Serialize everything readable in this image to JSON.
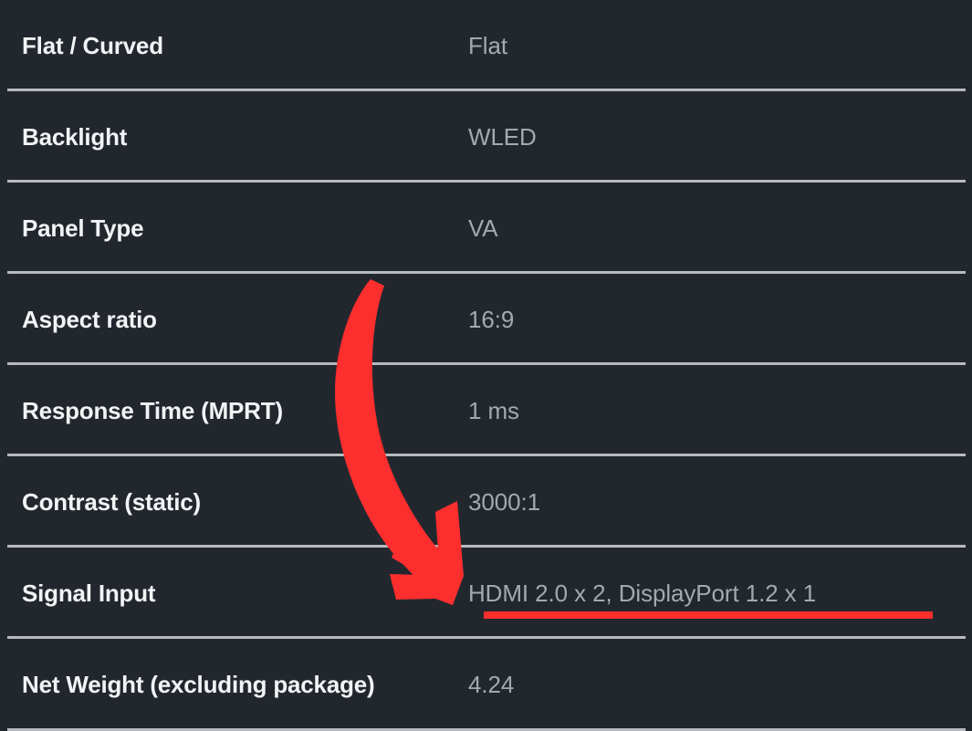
{
  "theme": {
    "background": "#22272e",
    "separator": "#b7babe",
    "label_color": "#f2f3f5",
    "value_color": "#a4a9b0",
    "marker_color": "#fc2e2e"
  },
  "spec_table": {
    "rows": [
      {
        "label": "Flat / Curved",
        "value": "Flat"
      },
      {
        "label": "Backlight",
        "value": "WLED"
      },
      {
        "label": "Panel Type",
        "value": "VA"
      },
      {
        "label": "Aspect ratio",
        "value": "16:9"
      },
      {
        "label": "Response Time (MPRT)",
        "value": "1 ms"
      },
      {
        "label": "Contrast (static)",
        "value": "3000:1"
      },
      {
        "label": "Signal Input",
        "value": "HDMI 2.0 x 2, DisplayPort 1.2 x 1"
      },
      {
        "label": "Net Weight (excluding package)",
        "value": "4.24"
      }
    ]
  },
  "annotations": {
    "arrow": {
      "name": "red-arrow-annotation",
      "color": "#fc2e2e",
      "points_to": "Signal Input value"
    },
    "underline": {
      "name": "red-underline-annotation",
      "color": "#fc2e2e",
      "underlines": "HDMI 2.0 x 2, DisplayPort 1.2 x 1"
    }
  }
}
